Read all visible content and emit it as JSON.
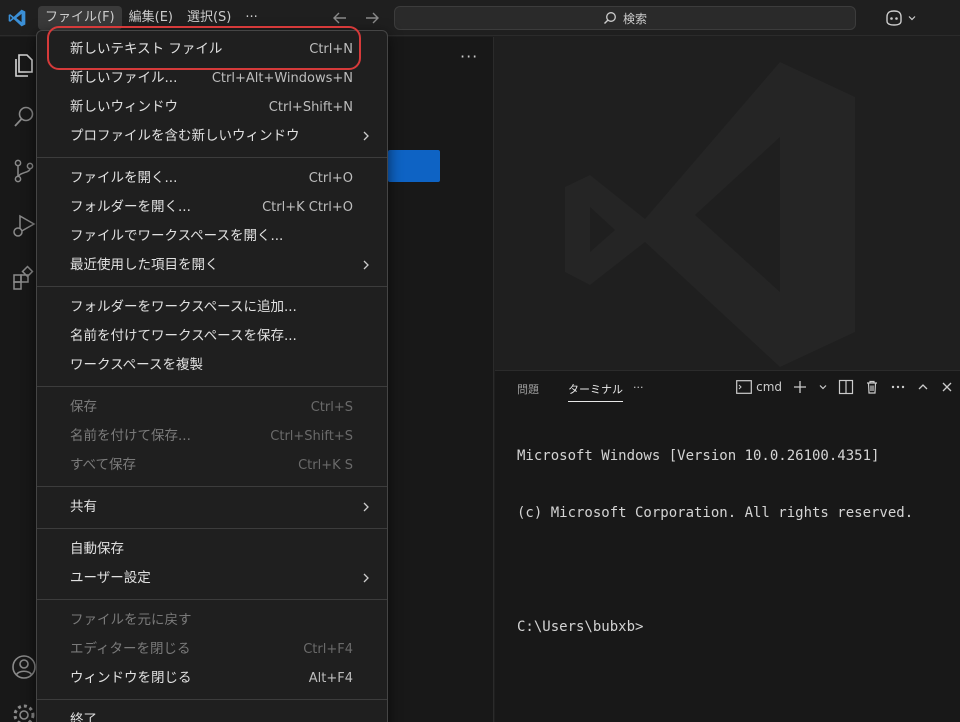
{
  "titlebar": {
    "menus": [
      {
        "label": "ファイル(F)"
      },
      {
        "label": "編集(E)"
      },
      {
        "label": "選択(S)"
      },
      {
        "label": "···"
      }
    ],
    "search_label": "検索",
    "back_icon": "arrow-left-icon",
    "forward_icon": "arrow-right-icon",
    "copilot_icon": "copilot-icon"
  },
  "file_menu": {
    "groups": [
      [
        {
          "label": "新しいテキスト ファイル",
          "shortcut": "Ctrl+N"
        },
        {
          "label": "新しいファイル...",
          "shortcut": "Ctrl+Alt+Windows+N"
        },
        {
          "label": "新しいウィンドウ",
          "shortcut": "Ctrl+Shift+N"
        },
        {
          "label": "プロファイルを含む新しいウィンドウ",
          "submenu": true
        }
      ],
      [
        {
          "label": "ファイルを開く...",
          "shortcut": "Ctrl+O"
        },
        {
          "label": "フォルダーを開く...",
          "shortcut": "Ctrl+K Ctrl+O"
        },
        {
          "label": "ファイルでワークスペースを開く..."
        },
        {
          "label": "最近使用した項目を開く",
          "submenu": true
        }
      ],
      [
        {
          "label": "フォルダーをワークスペースに追加..."
        },
        {
          "label": "名前を付けてワークスペースを保存..."
        },
        {
          "label": "ワークスペースを複製"
        }
      ],
      [
        {
          "label": "保存",
          "shortcut": "Ctrl+S",
          "disabled": true
        },
        {
          "label": "名前を付けて保存...",
          "shortcut": "Ctrl+Shift+S",
          "disabled": true
        },
        {
          "label": "すべて保存",
          "shortcut": "Ctrl+K S",
          "disabled": true
        }
      ],
      [
        {
          "label": "共有",
          "submenu": true
        }
      ],
      [
        {
          "label": "自動保存"
        },
        {
          "label": "ユーザー設定",
          "submenu": true
        }
      ],
      [
        {
          "label": "ファイルを元に戻す",
          "disabled": true
        },
        {
          "label": "エディターを閉じる",
          "shortcut": "Ctrl+F4",
          "disabled": true
        },
        {
          "label": "ウィンドウを閉じる",
          "shortcut": "Alt+F4"
        }
      ],
      [
        {
          "label": "終了"
        }
      ]
    ]
  },
  "panel": {
    "tabs": [
      {
        "label": "問題"
      },
      {
        "label": "ターミナル"
      },
      {
        "label": "···"
      }
    ],
    "terminal_profile": "cmd",
    "terminal_lines": [
      "Microsoft Windows [Version 10.0.26100.4351]",
      "(c) Microsoft Corporation. All rights reserved.",
      "",
      "C:\\Users\\bubxb>"
    ]
  },
  "sidebar": {
    "more_label": "···"
  },
  "colors": {
    "accent": "#0e63c4",
    "highlight_ring": "#d63a3a",
    "background": "#1f1f1f",
    "logo": "#3b8fd6"
  }
}
